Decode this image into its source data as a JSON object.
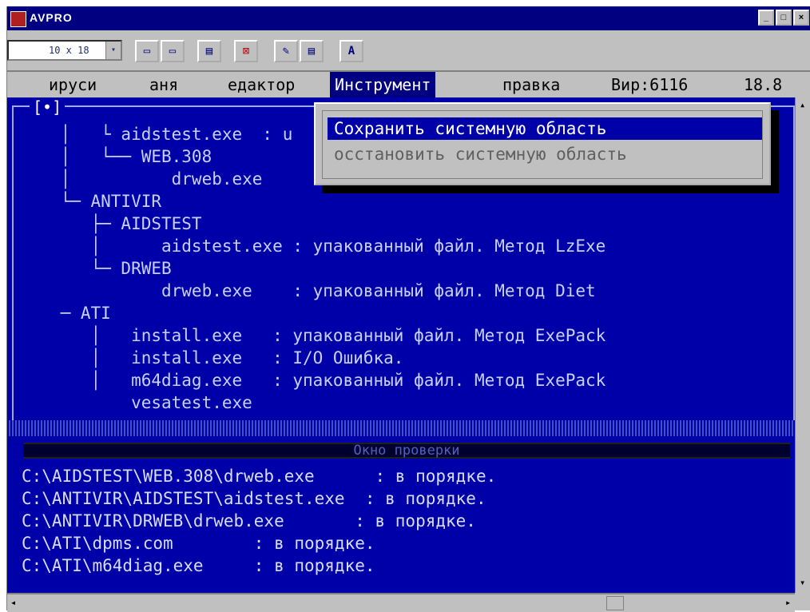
{
  "window": {
    "title": "AVPRO"
  },
  "window_buttons": {
    "minimize": "_",
    "maximize": "□",
    "close": "×"
  },
  "toolbar": {
    "font_size": "10 x 18",
    "font_drop": "▾",
    "buttons": [
      "▭",
      "▭",
      "▤",
      "⊠",
      "✎",
      "▤",
      "A"
    ]
  },
  "menu": {
    "items": [
      "ируси",
      "аня",
      "едактор",
      "Инструмент",
      "правка"
    ],
    "active_index": 3,
    "status": "Вир:6116",
    "status2": "18.8"
  },
  "dropdown": {
    "items": [
      {
        "label": "Сохранить системную область",
        "selected": true
      },
      {
        "label": "осстановить системную область",
        "selected": false
      }
    ]
  },
  "panel": {
    "close_box": "[•]",
    "lines": [
      "    │   └ aidstest.exe  : u",
      "    │   └── WEB.308",
      "    │          drweb.exe",
      "    └─ ANTIVIR",
      "       ├─ AIDSTEST",
      "       │      aidstest.exe : упакованный файл. Метод LzExe",
      "       └─ DRWEB",
      "              drweb.exe    : упакованный файл. Метод Diet",
      "    ─ ATI",
      "       │   install.exe   : упакованный файл. Метод ExePack",
      "       │   install.exe   : I/O Ошибка.",
      "       │   m64diag.exe   : упакованный файл. Метод ExePack",
      "           vesatest.exe"
    ]
  },
  "log": {
    "title": "Окно проверки",
    "lines": [
      "C:\\AIDSTEST\\WEB.308\\drweb.exe      : в порядке.",
      "C:\\ANTIVIR\\AIDSTEST\\aidstest.exe  : в порядке.",
      "C:\\ANTIVIR\\DRWEB\\drweb.exe       : в порядке.",
      "C:\\ATI\\dpms.com        : в порядке.",
      "C:\\ATI\\m64diag.exe     : в порядке."
    ]
  },
  "scroll": {
    "left": "◂",
    "right": "▸",
    "up": "▴",
    "down": "▾"
  },
  "colors": {
    "panel_bg": "#0000a8",
    "titlebar_bg": "#000080",
    "chrome": "#c0c0c0",
    "highlight": "#0000a8"
  }
}
